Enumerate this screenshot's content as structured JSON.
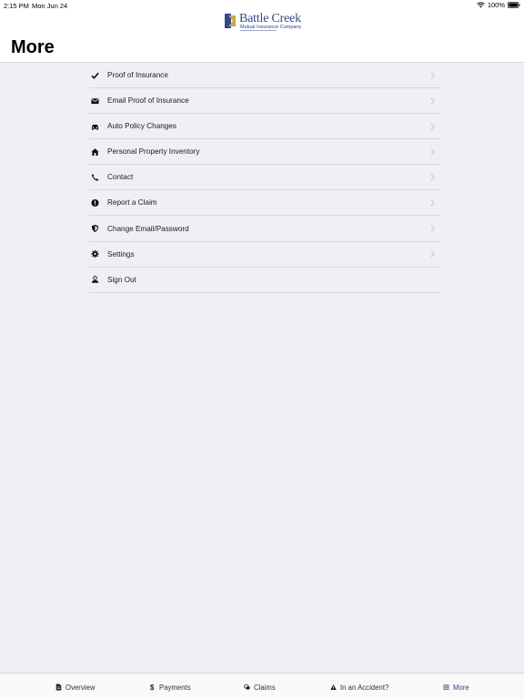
{
  "status_bar": {
    "time": "2:15 PM",
    "date": "Mon Jun 24",
    "battery": "100%"
  },
  "brand": {
    "name": "Battle Creek",
    "subtitle": "Mutual Insurance Company",
    "primary_color": "#2e4a8a",
    "accent_color": "#c8a64b"
  },
  "page": {
    "title": "More"
  },
  "menu": {
    "items": [
      {
        "label": "Proof of Insurance",
        "icon": "checkmark-icon",
        "has_chevron": true
      },
      {
        "label": "Email Proof of Insurance",
        "icon": "envelope-icon",
        "has_chevron": true
      },
      {
        "label": "Auto Policy Changes",
        "icon": "car-icon",
        "has_chevron": true
      },
      {
        "label": "Personal Property Inventory",
        "icon": "house-icon",
        "has_chevron": true
      },
      {
        "label": "Contact",
        "icon": "phone-icon",
        "has_chevron": true
      },
      {
        "label": "Report a Claim",
        "icon": "alert-circle-icon",
        "has_chevron": true
      },
      {
        "label": "Change Email/Password",
        "icon": "shield-icon",
        "has_chevron": true
      },
      {
        "label": "Settings",
        "icon": "gear-icon",
        "has_chevron": true
      },
      {
        "label": "Sign Out",
        "icon": "user-icon",
        "has_chevron": false
      }
    ]
  },
  "tab_bar": {
    "tabs": [
      {
        "label": "Overview",
        "icon": "document-icon",
        "active": false
      },
      {
        "label": "Payments",
        "icon": "dollar-icon",
        "active": false
      },
      {
        "label": "Claims",
        "icon": "chat-bubbles-icon",
        "active": false
      },
      {
        "label": "In an Accident?",
        "icon": "warning-icon",
        "active": false
      },
      {
        "label": "More",
        "icon": "menu-lines-icon",
        "active": true
      }
    ]
  }
}
